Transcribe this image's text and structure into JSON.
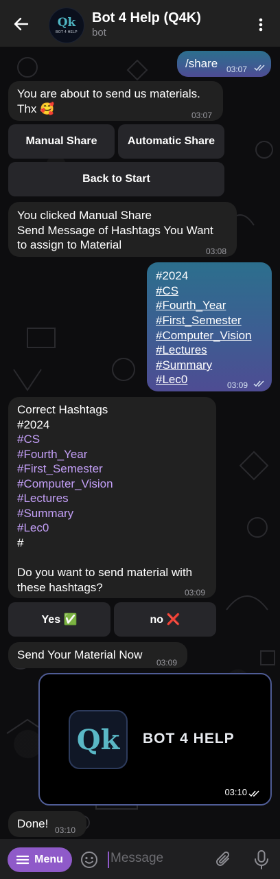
{
  "header": {
    "title": "Bot 4 Help (Q4K)",
    "subtitle": "bot",
    "avatar_mark": "Qk",
    "avatar_caption": "BOT 4 HELP"
  },
  "messages": {
    "m1": {
      "text": "/share",
      "time": "03:07"
    },
    "m2": {
      "text": "You are about to send us materials.",
      "text2": "Thx 🥰",
      "time": "03:07"
    },
    "kb1": {
      "manual": "Manual Share",
      "automatic": "Automatic Share",
      "back": "Back to Start"
    },
    "m3": {
      "line1": "You clicked Manual Share",
      "line2": "Send Message of Hashtags You Want",
      "line3": "to assign to Material",
      "time": "03:08"
    },
    "m4": {
      "lines": [
        "#2024",
        "#CS",
        "#Fourth_Year",
        "#First_Semester",
        "#Computer_Vision",
        "#Lectures",
        "#Summary",
        "#Lec0"
      ],
      "time": "03:09"
    },
    "m5": {
      "heading": "Correct Hashtags",
      "year": "#2024",
      "tags": [
        "#CS",
        "#Fourth_Year",
        "#First_Semester",
        "#Computer_Vision",
        "#Lectures",
        "#Summary",
        "#Lec0"
      ],
      "hash": "#",
      "question1": "Do you want to send material with",
      "question2": "these hashtags?",
      "time": "03:09"
    },
    "kb2": {
      "yes": "Yes ✅",
      "no": "no ❌"
    },
    "m6": {
      "text": "Send Your Material Now",
      "time": "03:09"
    },
    "photo": {
      "logo_mark": "Qk",
      "logo_text": "BOT 4 HELP",
      "time": "03:10"
    },
    "m7": {
      "text": "Done!",
      "time": "03:10"
    }
  },
  "input": {
    "menu_label": "Menu",
    "placeholder": "Message"
  },
  "colors": {
    "accent": "#8f5ac9",
    "hashtag": "#c39ff7",
    "bubble_in": "#212121",
    "header": "#212121"
  },
  "icons": [
    "back-arrow-icon",
    "more-vert-icon",
    "double-check-icon",
    "emoji-icon",
    "attach-icon",
    "mic-icon",
    "menu-icon"
  ]
}
